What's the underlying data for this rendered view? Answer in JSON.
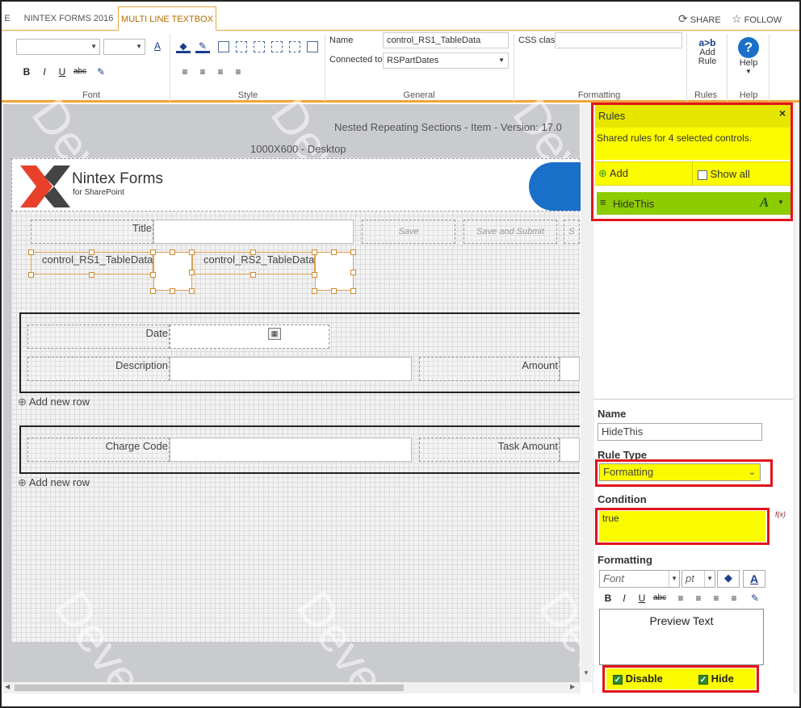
{
  "tabs": {
    "partial": "E",
    "nintex": "NINTEX FORMS 2016",
    "active": "MULTI LINE TEXTBOX"
  },
  "header_actions": {
    "share": "SHARE",
    "follow": "FOLLOW"
  },
  "ribbon": {
    "groups": {
      "font": "Font",
      "style": "Style",
      "general": "General",
      "formatting": "Formatting",
      "rules": "Rules",
      "help": "Help"
    },
    "font_buttons": {
      "bold": "B",
      "italic": "I",
      "underline": "U",
      "strike": "abc"
    },
    "general": {
      "name_label": "Name",
      "name_value": "control_RS1_TableData",
      "connected_label": "Connected to",
      "connected_value": "RSPartDates"
    },
    "formatting": {
      "css_label": "CSS class"
    },
    "add_rule": {
      "line1": "Add",
      "line2": "Rule",
      "icon_text": "a>b"
    },
    "help": {
      "label": "Help",
      "icon": "?"
    }
  },
  "canvas": {
    "form_title": "Nested Repeating Sections - Item - Version: 17.0",
    "layout": "1000X600 - Desktop",
    "logo": {
      "brand": "Nintex",
      "brand2": "Forms",
      "sub": "for SharePoint"
    },
    "title_label": "Title",
    "buttons": {
      "save": "Save",
      "save_submit": "Save and Submit",
      "partial": "S"
    },
    "control1": "control_RS1_TableData",
    "control2": "control_RS2_TableData",
    "section1": {
      "date": "Date",
      "description": "Description",
      "amount": "Amount"
    },
    "section2": {
      "charge_code": "Charge Code",
      "task_amount": "Task Amount"
    },
    "add_new_row": "Add new row",
    "watermark": "Deve"
  },
  "rules_panel": {
    "title": "Rules",
    "close": "×",
    "shared": "Shared rules for 4 selected controls.",
    "add": "Add",
    "show_all": "Show all",
    "rule_name": "HideThis",
    "rule_icon": "A"
  },
  "properties": {
    "name_label": "Name",
    "name_value": "HideThis",
    "rule_type_label": "Rule Type",
    "rule_type_value": "Formatting",
    "condition_label": "Condition",
    "condition_value": "true",
    "fx": "f(x)",
    "formatting_label": "Formatting",
    "font_placeholder": "Font",
    "size_placeholder": "pt",
    "preview": "Preview Text",
    "disable": "Disable",
    "hide": "Hide"
  },
  "colors": {
    "accent": "#e8a33c",
    "highlight": "#fbfb00",
    "rule_green": "#8ccc00",
    "border_red": "#e1141b"
  }
}
